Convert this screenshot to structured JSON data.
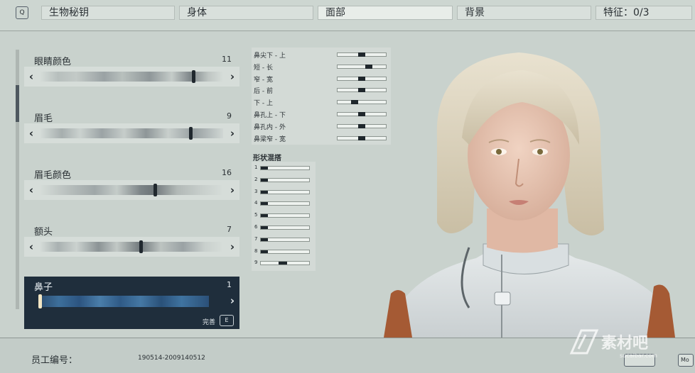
{
  "topbar": {
    "key_hint": "Q",
    "tabs": [
      {
        "label": "生物秘钥",
        "active": false
      },
      {
        "label": "身体",
        "active": false
      },
      {
        "label": "面部",
        "active": true
      },
      {
        "label": "背景",
        "active": false
      },
      {
        "label": "特征：0/3",
        "active": false
      }
    ]
  },
  "left_panel": {
    "items": [
      {
        "label": "眼睛颜色",
        "value": "11",
        "selected": false
      },
      {
        "label": "眉毛",
        "value": "9",
        "selected": false
      },
      {
        "label": "眉毛颜色",
        "value": "16",
        "selected": false
      },
      {
        "label": "额头",
        "value": "7",
        "selected": false
      },
      {
        "label": "鼻子",
        "value": "1",
        "selected": true
      }
    ],
    "arrow_left": "‹",
    "arrow_right": "›",
    "done_label": "完善",
    "done_key": "E"
  },
  "sliders": [
    {
      "label": "鼻尖下 - 上",
      "value": 0.5
    },
    {
      "label": "短 - 长",
      "value": 0.65
    },
    {
      "label": "窄 - 宽",
      "value": 0.5
    },
    {
      "label": "后 - 前",
      "value": 0.5
    },
    {
      "label": "下 - 上",
      "value": 0.35
    },
    {
      "label": "鼻孔上 - 下",
      "value": 0.5
    },
    {
      "label": "鼻孔内 - 外",
      "value": 0.5
    },
    {
      "label": "鼻梁窄 - 宽",
      "value": 0.5
    }
  ],
  "blend": {
    "title": "形状混搭",
    "rows": [
      {
        "label": "1",
        "value": 0.15
      },
      {
        "label": "2",
        "value": 0.15
      },
      {
        "label": "3",
        "value": 0.15
      },
      {
        "label": "4",
        "value": 0.15
      },
      {
        "label": "5",
        "value": 0.15
      },
      {
        "label": "6",
        "value": 0.15
      },
      {
        "label": "7",
        "value": 0.15
      },
      {
        "label": "8",
        "value": 0.15
      },
      {
        "label": "9",
        "value": 0.45
      }
    ]
  },
  "bottombar": {
    "employee_label": "员工编号：",
    "employee_value": "190514-2009140512",
    "btn_right_1": "",
    "btn_right_2": "Mo"
  },
  "watermark": {
    "text": "素材吧",
    "url": "sucaibar.com"
  },
  "colors": {
    "background": "#c9d2cd",
    "selected_item": "#1f2e3c",
    "slider_knob": "#1f272c"
  }
}
